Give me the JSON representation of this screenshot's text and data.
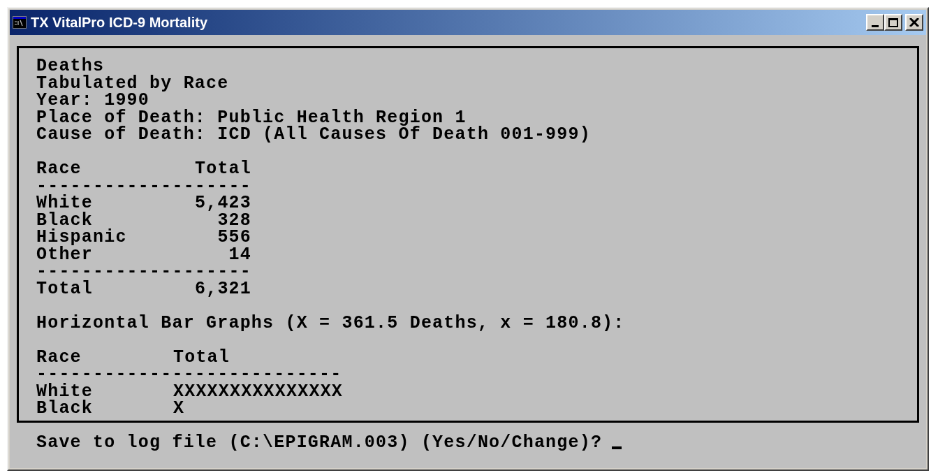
{
  "window": {
    "title": "TX VitalPro ICD-9 Mortality"
  },
  "report": {
    "heading_lines": [
      "Deaths",
      "Tabulated by Race",
      "Year: 1990",
      "Place of Death: Public Health Region 1",
      "Cause of Death: ICD (All Causes Of Death 001-999)"
    ],
    "summary_table": {
      "columns": [
        "Race",
        "Total"
      ],
      "rule_top": "-------------------",
      "rows": [
        {
          "race": "White",
          "total": "5,423"
        },
        {
          "race": "Black",
          "total": "328"
        },
        {
          "race": "Hispanic",
          "total": "556"
        },
        {
          "race": "Other",
          "total": "14"
        }
      ],
      "rule_bottom": "-------------------",
      "total_row": {
        "label": "Total",
        "total": "6,321"
      }
    },
    "bar_graph": {
      "title": "Horizontal Bar Graphs (X = 361.5 Deaths, x = 180.8):",
      "columns": [
        "Race",
        "Total"
      ],
      "rule": "---------------------------",
      "rows": [
        {
          "race": "White",
          "bar": "XXXXXXXXXXXXXXX"
        },
        {
          "race": "Black",
          "bar": "X"
        }
      ]
    }
  },
  "prompt": "Save to log file (C:\\EPIGRAM.003) (Yes/No/Change)?"
}
